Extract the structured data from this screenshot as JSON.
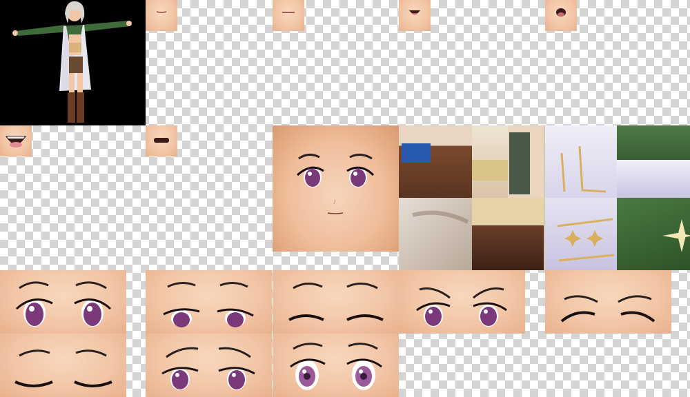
{
  "canvas": {
    "background": "transparency-checkerboard",
    "checker_colors": [
      "#ffffff",
      "#d4d4d4"
    ]
  },
  "character_preview": {
    "icon": "character-tpose-model",
    "background_color": "#000000",
    "hair_color": "#d9d6d0",
    "coat_color": "#3f6b3a",
    "boots_color": "#6b3b22"
  },
  "mouth_textures": [
    {
      "name": "mouth-neutral-small",
      "shape": "line"
    },
    {
      "name": "mouth-neutral-flat",
      "shape": "line"
    },
    {
      "name": "mouth-open-small",
      "shape": "open"
    },
    {
      "name": "mouth-open-round",
      "shape": "open"
    },
    {
      "name": "mouth-open-wide",
      "shape": "wide"
    },
    {
      "name": "mouth-closed-dark",
      "shape": "dark"
    }
  ],
  "face_texture": {
    "name": "face-base",
    "eye_color": "#7a3a7a",
    "skin_color": "#efbd9a"
  },
  "clothing_atlas": {
    "name": "clothing-texture-atlas",
    "colors": [
      "#7a4a2e",
      "#c9c0b4",
      "#3f6b3a",
      "#e9e4f2",
      "#d9b980",
      "#5a3a2a"
    ]
  },
  "eye_textures": [
    {
      "name": "eyes-open-neutral",
      "state": "open"
    },
    {
      "name": "eyes-open-half",
      "state": "half"
    },
    {
      "name": "eyes-closed-happy",
      "state": "closed"
    },
    {
      "name": "eyes-angry",
      "state": "angry"
    },
    {
      "name": "eyes-closed-squint",
      "state": "squint"
    },
    {
      "name": "eyes-closed-peaceful",
      "state": "closed-lower"
    },
    {
      "name": "eyes-sad-worried",
      "state": "sad"
    },
    {
      "name": "eyes-surprised",
      "state": "surprised"
    }
  ]
}
